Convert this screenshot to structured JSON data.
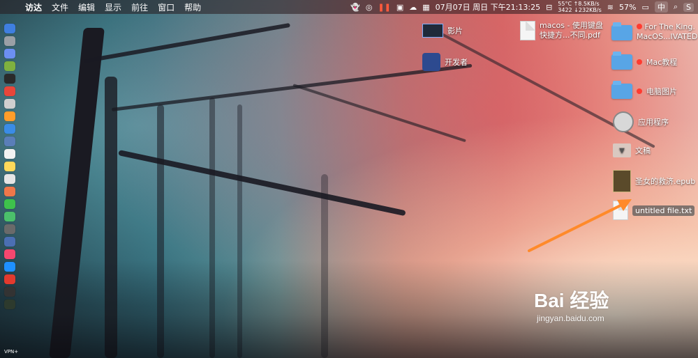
{
  "menubar": {
    "apple_icon": "apple-icon",
    "items": [
      "访达",
      "文件",
      "编辑",
      "显示",
      "前往",
      "窗口",
      "帮助"
    ],
    "status": {
      "cpu_temp": "55°C",
      "upload": "↑8.5KB/s",
      "mem": "3422",
      "download": "↓232KB/s",
      "date_time": "07月07日 周日 下午21:13:25",
      "battery": "57%",
      "input_method": "中"
    }
  },
  "desktop_icons": [
    {
      "label": "For The King.",
      "label2": "MacOS...IVATED",
      "type": "folder",
      "tag": "red"
    },
    {
      "label": "Mac教程",
      "type": "folder",
      "tag": "red"
    },
    {
      "label": "电脑图片",
      "type": "folder",
      "tag": "red"
    },
    {
      "label": "应用程序",
      "type": "app"
    },
    {
      "label": "文稿",
      "type": "folder-down"
    },
    {
      "label": "圣女的救济.epub",
      "type": "book"
    },
    {
      "label": "untitled file.txt",
      "type": "txt",
      "selected": true
    }
  ],
  "top_icons": [
    {
      "label": "影片"
    },
    {
      "label": "开发者"
    },
    {
      "label": "macos - 使用键盘",
      "label2": "快捷方...不同.pdf"
    }
  ],
  "dock_label": "VPN+",
  "watermark": {
    "main": "Bai 经验",
    "sub": "jingyan.baidu.com"
  },
  "colors": {
    "arrow": "#ff8a2a",
    "folder": "#58a5e6",
    "tag_red": "#ff3b30"
  }
}
